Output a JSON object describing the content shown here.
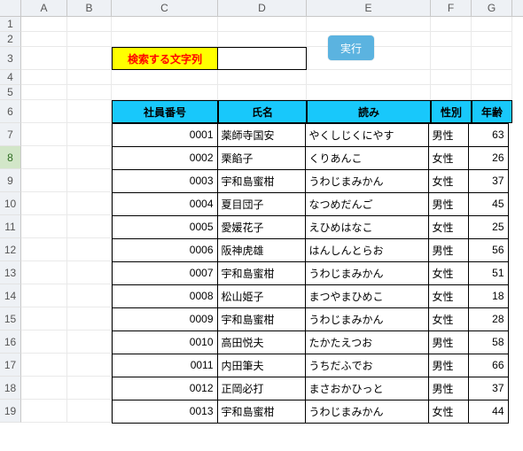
{
  "columns": [
    "A",
    "B",
    "C",
    "D",
    "E",
    "F",
    "G"
  ],
  "search": {
    "label": "検索する文字列",
    "value": ""
  },
  "button": {
    "execute": "実行"
  },
  "headers": {
    "id": "社員番号",
    "name": "氏名",
    "reading": "読み",
    "gender": "性別",
    "age": "年齢"
  },
  "chart_data": {
    "type": "table",
    "title": "",
    "columns": [
      "社員番号",
      "氏名",
      "読み",
      "性別",
      "年齢"
    ],
    "rows": [
      {
        "id": "0001",
        "name": "薬師寺国安",
        "reading": "やくしじくにやす",
        "gender": "男性",
        "age": 63
      },
      {
        "id": "0002",
        "name": "栗餡子",
        "reading": "くりあんこ",
        "gender": "女性",
        "age": 26
      },
      {
        "id": "0003",
        "name": "宇和島蜜柑",
        "reading": "うわじまみかん",
        "gender": "女性",
        "age": 37
      },
      {
        "id": "0004",
        "name": "夏目団子",
        "reading": "なつめだんご",
        "gender": "男性",
        "age": 45
      },
      {
        "id": "0005",
        "name": "愛媛花子",
        "reading": "えひめはなこ",
        "gender": "女性",
        "age": 25
      },
      {
        "id": "0006",
        "name": "阪神虎雄",
        "reading": "はんしんとらお",
        "gender": "男性",
        "age": 56
      },
      {
        "id": "0007",
        "name": "宇和島蜜柑",
        "reading": "うわじまみかん",
        "gender": "女性",
        "age": 51
      },
      {
        "id": "0008",
        "name": "松山姫子",
        "reading": "まつやまひめこ",
        "gender": "女性",
        "age": 18
      },
      {
        "id": "0009",
        "name": "宇和島蜜柑",
        "reading": "うわじまみかん",
        "gender": "女性",
        "age": 28
      },
      {
        "id": "0010",
        "name": "高田悦夫",
        "reading": "たかたえつお",
        "gender": "男性",
        "age": 58
      },
      {
        "id": "0011",
        "name": "内田筆夫",
        "reading": "うちだふでお",
        "gender": "男性",
        "age": 66
      },
      {
        "id": "0012",
        "name": "正岡必打",
        "reading": "まさおかひっと",
        "gender": "男性",
        "age": 37
      },
      {
        "id": "0013",
        "name": "宇和島蜜柑",
        "reading": "うわじまみかん",
        "gender": "女性",
        "age": 44
      }
    ]
  },
  "selected_row_header": 8
}
